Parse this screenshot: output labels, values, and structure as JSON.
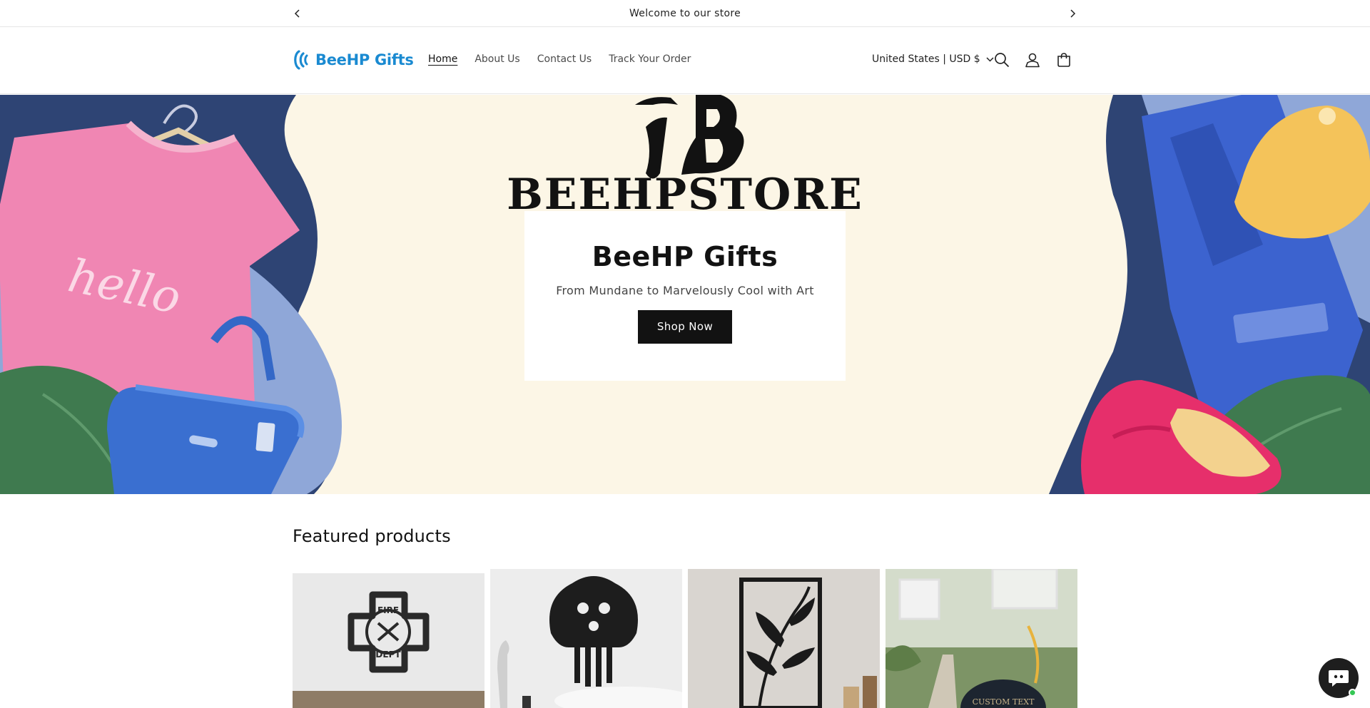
{
  "announcement": {
    "text": "Welcome to our store",
    "prev_icon": "chevron-left-icon",
    "next_icon": "chevron-right-icon"
  },
  "header": {
    "logo_text": "BeeHP Gifts",
    "nav": [
      "Home",
      "About Us",
      "Contact Us",
      "Track Your Order"
    ],
    "active_nav": "Home",
    "country_selector": "United States | USD $",
    "icons": [
      "search-icon",
      "account-icon",
      "cart-icon"
    ]
  },
  "hero": {
    "brand_image_text": "BEEHPSTORE",
    "title": "BeeHP Gifts",
    "subtitle": "From Mundane to Marvelously Cool with Art",
    "button_label": "Shop Now",
    "shirt_text": "hello"
  },
  "featured": {
    "title": "Featured products",
    "products": [
      {
        "image": "fire-dept-metal-sign"
      },
      {
        "image": "hair-pick-metal-art"
      },
      {
        "image": "floral-panel-metal-art"
      },
      {
        "image": "custom-garden-sign"
      }
    ],
    "custom_sign_text": "CUSTOM TEXT",
    "fire_sign_text": [
      "FIRE",
      "DEPT"
    ]
  },
  "colors": {
    "brand_blue": "#1a8ad1",
    "hero_bg": "#fcf6e6",
    "button_bg": "#121212"
  }
}
